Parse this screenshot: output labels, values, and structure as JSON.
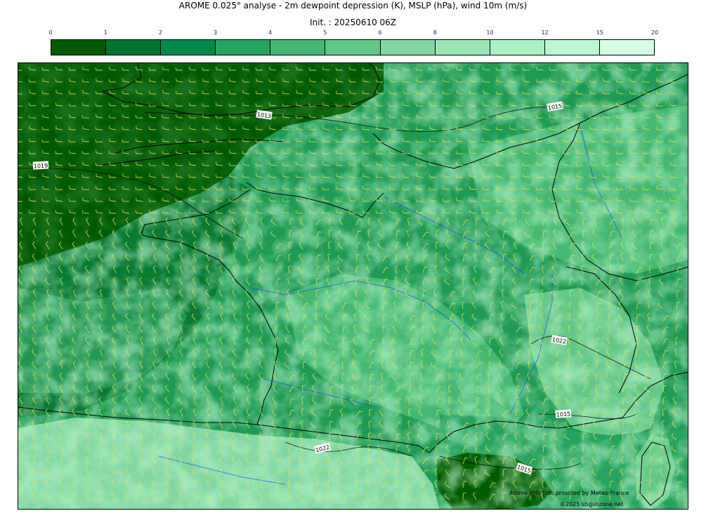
{
  "header": {
    "title": "AROME 0.025° analyse - 2m dewpoint depression (K), MSLP (hPa), wind 10m (m/s)",
    "init": "Init. : 20250610 06Z"
  },
  "colorbar": {
    "ticks": [
      "0",
      "1",
      "2",
      "3",
      "4",
      "5",
      "6",
      "8",
      "10",
      "12",
      "15",
      "20"
    ],
    "colors": [
      "#005a00",
      "#007530",
      "#00894a",
      "#27a25f",
      "#46b873",
      "#64c787",
      "#84d7a2",
      "#9be6b7",
      "#aef0c6",
      "#bdf6d2",
      "#d5fde3"
    ]
  },
  "map": {
    "isobar_labels": [
      {
        "text": "1013"
      },
      {
        "text": "1019"
      },
      {
        "text": "1015"
      },
      {
        "text": "1022"
      },
      {
        "text": "1015"
      },
      {
        "text": "1022"
      },
      {
        "text": "1015"
      }
    ],
    "colors": {
      "sea_dark": "#005a00",
      "coast": "#000000",
      "river": "#1f3fff",
      "barb": "#e6e64a"
    }
  },
  "credits": {
    "line1": "Arome grib files provided by  Meteo-France",
    "line2": "©2025 sb@inzone.net"
  }
}
